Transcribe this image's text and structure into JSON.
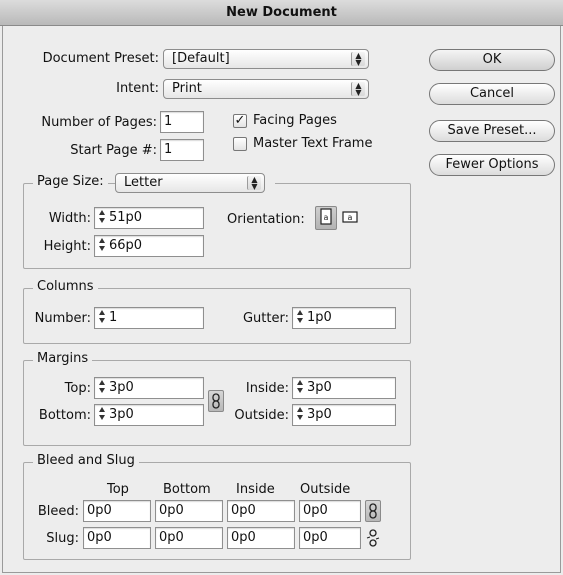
{
  "window": {
    "title": "New Document"
  },
  "preset": {
    "label": "Document Preset:",
    "value": "[Default]"
  },
  "intent": {
    "label": "Intent:",
    "value": "Print"
  },
  "pages": {
    "number_label": "Number of Pages:",
    "number_value": "1",
    "start_label": "Start Page #:",
    "start_value": "1",
    "facing_label": "Facing Pages",
    "facing_checked": true,
    "master_label": "Master Text Frame",
    "master_checked": false
  },
  "buttons": {
    "ok": "OK",
    "cancel": "Cancel",
    "save_preset": "Save Preset...",
    "fewer_options": "Fewer Options"
  },
  "page_size": {
    "label": "Page Size:",
    "value": "Letter",
    "width_label": "Width:",
    "width_value": "51p0",
    "height_label": "Height:",
    "height_value": "66p0",
    "orientation_label": "Orientation:"
  },
  "columns": {
    "title": "Columns",
    "number_label": "Number:",
    "number_value": "1",
    "gutter_label": "Gutter:",
    "gutter_value": "1p0"
  },
  "margins": {
    "title": "Margins",
    "top_label": "Top:",
    "top_value": "3p0",
    "bottom_label": "Bottom:",
    "bottom_value": "3p0",
    "inside_label": "Inside:",
    "inside_value": "3p0",
    "outside_label": "Outside:",
    "outside_value": "3p0"
  },
  "bleed_slug": {
    "title": "Bleed and Slug",
    "headers": [
      "Top",
      "Bottom",
      "Inside",
      "Outside"
    ],
    "bleed_label": "Bleed:",
    "bleed_values": [
      "0p0",
      "0p0",
      "0p0",
      "0p0"
    ],
    "slug_label": "Slug:",
    "slug_values": [
      "0p0",
      "0p0",
      "0p0",
      "0p0"
    ]
  },
  "icons": {
    "portrait": "portrait-orientation-icon",
    "landscape": "landscape-orientation-icon",
    "chain_linked": "chain-link-icon",
    "chain_broken": "chain-broken-icon"
  }
}
